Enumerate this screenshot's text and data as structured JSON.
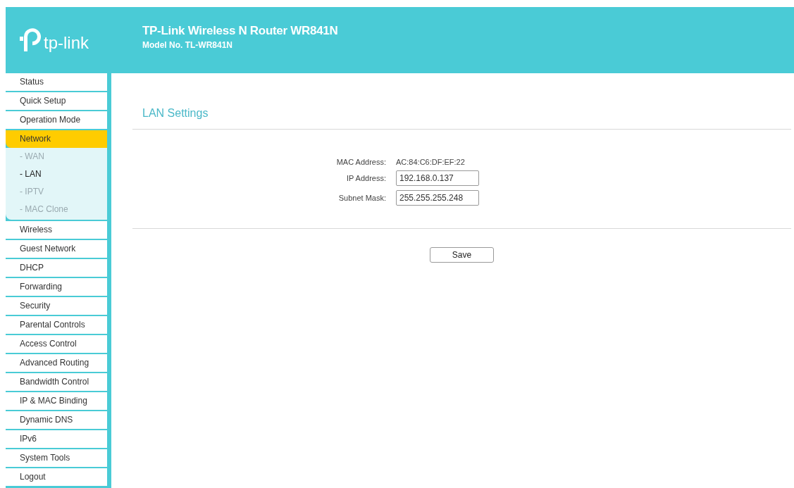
{
  "header": {
    "logo_text": "tp-link",
    "title": "TP-Link Wireless N Router WR841N",
    "model": "Model No. TL-WR841N"
  },
  "sidebar": {
    "items": [
      {
        "label": "Status",
        "selected": false
      },
      {
        "label": "Quick Setup",
        "selected": false
      },
      {
        "label": "Operation Mode",
        "selected": false
      },
      {
        "label": "Network",
        "selected": true,
        "expanded": true,
        "children": [
          {
            "label": "- WAN",
            "selected": false
          },
          {
            "label": "- LAN",
            "selected": true
          },
          {
            "label": "- IPTV",
            "selected": false
          },
          {
            "label": "- MAC Clone",
            "selected": false
          }
        ]
      },
      {
        "label": "Wireless",
        "selected": false
      },
      {
        "label": "Guest Network",
        "selected": false
      },
      {
        "label": "DHCP",
        "selected": false
      },
      {
        "label": "Forwarding",
        "selected": false
      },
      {
        "label": "Security",
        "selected": false
      },
      {
        "label": "Parental Controls",
        "selected": false
      },
      {
        "label": "Access Control",
        "selected": false
      },
      {
        "label": "Advanced Routing",
        "selected": false
      },
      {
        "label": "Bandwidth Control",
        "selected": false
      },
      {
        "label": "IP & MAC Binding",
        "selected": false
      },
      {
        "label": "Dynamic DNS",
        "selected": false
      },
      {
        "label": "IPv6",
        "selected": false
      },
      {
        "label": "System Tools",
        "selected": false
      },
      {
        "label": "Logout",
        "selected": false
      }
    ]
  },
  "content": {
    "title": "LAN Settings",
    "fields": [
      {
        "kind": "text",
        "label": "MAC Address:",
        "value": "AC:84:C6:DF:EF:22"
      },
      {
        "kind": "input",
        "label": "IP Address:",
        "value": "192.168.0.137"
      },
      {
        "kind": "input",
        "label": "Subnet Mask:",
        "value": "255.255.255.248"
      }
    ],
    "save_button": "Save"
  }
}
